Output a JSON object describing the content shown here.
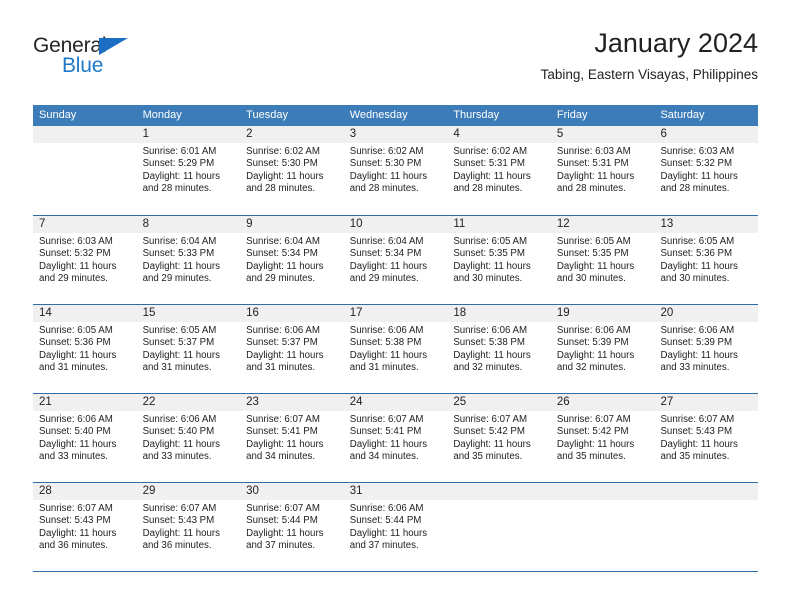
{
  "logo": {
    "text_primary": "General",
    "text_secondary": "Blue",
    "triangle_icon": "blue-triangle-icon",
    "colors": {
      "primary": "#262626",
      "secondary": "#2079c8",
      "triangle": "#1b6ec2"
    }
  },
  "header": {
    "title": "January 2024",
    "subtitle": "Tabing, Eastern Visayas, Philippines"
  },
  "theme": {
    "header_bg": "#3c7cb8",
    "header_text": "#ffffff",
    "row_divider": "#2e6da8",
    "daynum_band_bg": "#f0f0f0",
    "body_text": "#222222"
  },
  "weekdays": [
    "Sunday",
    "Monday",
    "Tuesday",
    "Wednesday",
    "Thursday",
    "Friday",
    "Saturday"
  ],
  "weeks": [
    [
      {
        "day": "",
        "sunrise": "",
        "sunset": "",
        "daylight_line1": "",
        "daylight_line2": "",
        "empty": true
      },
      {
        "day": "1",
        "sunrise": "Sunrise: 6:01 AM",
        "sunset": "Sunset: 5:29 PM",
        "daylight_line1": "Daylight: 11 hours",
        "daylight_line2": "and 28 minutes."
      },
      {
        "day": "2",
        "sunrise": "Sunrise: 6:02 AM",
        "sunset": "Sunset: 5:30 PM",
        "daylight_line1": "Daylight: 11 hours",
        "daylight_line2": "and 28 minutes."
      },
      {
        "day": "3",
        "sunrise": "Sunrise: 6:02 AM",
        "sunset": "Sunset: 5:30 PM",
        "daylight_line1": "Daylight: 11 hours",
        "daylight_line2": "and 28 minutes."
      },
      {
        "day": "4",
        "sunrise": "Sunrise: 6:02 AM",
        "sunset": "Sunset: 5:31 PM",
        "daylight_line1": "Daylight: 11 hours",
        "daylight_line2": "and 28 minutes."
      },
      {
        "day": "5",
        "sunrise": "Sunrise: 6:03 AM",
        "sunset": "Sunset: 5:31 PM",
        "daylight_line1": "Daylight: 11 hours",
        "daylight_line2": "and 28 minutes."
      },
      {
        "day": "6",
        "sunrise": "Sunrise: 6:03 AM",
        "sunset": "Sunset: 5:32 PM",
        "daylight_line1": "Daylight: 11 hours",
        "daylight_line2": "and 28 minutes."
      }
    ],
    [
      {
        "day": "7",
        "sunrise": "Sunrise: 6:03 AM",
        "sunset": "Sunset: 5:32 PM",
        "daylight_line1": "Daylight: 11 hours",
        "daylight_line2": "and 29 minutes."
      },
      {
        "day": "8",
        "sunrise": "Sunrise: 6:04 AM",
        "sunset": "Sunset: 5:33 PM",
        "daylight_line1": "Daylight: 11 hours",
        "daylight_line2": "and 29 minutes."
      },
      {
        "day": "9",
        "sunrise": "Sunrise: 6:04 AM",
        "sunset": "Sunset: 5:34 PM",
        "daylight_line1": "Daylight: 11 hours",
        "daylight_line2": "and 29 minutes."
      },
      {
        "day": "10",
        "sunrise": "Sunrise: 6:04 AM",
        "sunset": "Sunset: 5:34 PM",
        "daylight_line1": "Daylight: 11 hours",
        "daylight_line2": "and 29 minutes."
      },
      {
        "day": "11",
        "sunrise": "Sunrise: 6:05 AM",
        "sunset": "Sunset: 5:35 PM",
        "daylight_line1": "Daylight: 11 hours",
        "daylight_line2": "and 30 minutes."
      },
      {
        "day": "12",
        "sunrise": "Sunrise: 6:05 AM",
        "sunset": "Sunset: 5:35 PM",
        "daylight_line1": "Daylight: 11 hours",
        "daylight_line2": "and 30 minutes."
      },
      {
        "day": "13",
        "sunrise": "Sunrise: 6:05 AM",
        "sunset": "Sunset: 5:36 PM",
        "daylight_line1": "Daylight: 11 hours",
        "daylight_line2": "and 30 minutes."
      }
    ],
    [
      {
        "day": "14",
        "sunrise": "Sunrise: 6:05 AM",
        "sunset": "Sunset: 5:36 PM",
        "daylight_line1": "Daylight: 11 hours",
        "daylight_line2": "and 31 minutes."
      },
      {
        "day": "15",
        "sunrise": "Sunrise: 6:05 AM",
        "sunset": "Sunset: 5:37 PM",
        "daylight_line1": "Daylight: 11 hours",
        "daylight_line2": "and 31 minutes."
      },
      {
        "day": "16",
        "sunrise": "Sunrise: 6:06 AM",
        "sunset": "Sunset: 5:37 PM",
        "daylight_line1": "Daylight: 11 hours",
        "daylight_line2": "and 31 minutes."
      },
      {
        "day": "17",
        "sunrise": "Sunrise: 6:06 AM",
        "sunset": "Sunset: 5:38 PM",
        "daylight_line1": "Daylight: 11 hours",
        "daylight_line2": "and 31 minutes."
      },
      {
        "day": "18",
        "sunrise": "Sunrise: 6:06 AM",
        "sunset": "Sunset: 5:38 PM",
        "daylight_line1": "Daylight: 11 hours",
        "daylight_line2": "and 32 minutes."
      },
      {
        "day": "19",
        "sunrise": "Sunrise: 6:06 AM",
        "sunset": "Sunset: 5:39 PM",
        "daylight_line1": "Daylight: 11 hours",
        "daylight_line2": "and 32 minutes."
      },
      {
        "day": "20",
        "sunrise": "Sunrise: 6:06 AM",
        "sunset": "Sunset: 5:39 PM",
        "daylight_line1": "Daylight: 11 hours",
        "daylight_line2": "and 33 minutes."
      }
    ],
    [
      {
        "day": "21",
        "sunrise": "Sunrise: 6:06 AM",
        "sunset": "Sunset: 5:40 PM",
        "daylight_line1": "Daylight: 11 hours",
        "daylight_line2": "and 33 minutes."
      },
      {
        "day": "22",
        "sunrise": "Sunrise: 6:06 AM",
        "sunset": "Sunset: 5:40 PM",
        "daylight_line1": "Daylight: 11 hours",
        "daylight_line2": "and 33 minutes."
      },
      {
        "day": "23",
        "sunrise": "Sunrise: 6:07 AM",
        "sunset": "Sunset: 5:41 PM",
        "daylight_line1": "Daylight: 11 hours",
        "daylight_line2": "and 34 minutes."
      },
      {
        "day": "24",
        "sunrise": "Sunrise: 6:07 AM",
        "sunset": "Sunset: 5:41 PM",
        "daylight_line1": "Daylight: 11 hours",
        "daylight_line2": "and 34 minutes."
      },
      {
        "day": "25",
        "sunrise": "Sunrise: 6:07 AM",
        "sunset": "Sunset: 5:42 PM",
        "daylight_line1": "Daylight: 11 hours",
        "daylight_line2": "and 35 minutes."
      },
      {
        "day": "26",
        "sunrise": "Sunrise: 6:07 AM",
        "sunset": "Sunset: 5:42 PM",
        "daylight_line1": "Daylight: 11 hours",
        "daylight_line2": "and 35 minutes."
      },
      {
        "day": "27",
        "sunrise": "Sunrise: 6:07 AM",
        "sunset": "Sunset: 5:43 PM",
        "daylight_line1": "Daylight: 11 hours",
        "daylight_line2": "and 35 minutes."
      }
    ],
    [
      {
        "day": "28",
        "sunrise": "Sunrise: 6:07 AM",
        "sunset": "Sunset: 5:43 PM",
        "daylight_line1": "Daylight: 11 hours",
        "daylight_line2": "and 36 minutes."
      },
      {
        "day": "29",
        "sunrise": "Sunrise: 6:07 AM",
        "sunset": "Sunset: 5:43 PM",
        "daylight_line1": "Daylight: 11 hours",
        "daylight_line2": "and 36 minutes."
      },
      {
        "day": "30",
        "sunrise": "Sunrise: 6:07 AM",
        "sunset": "Sunset: 5:44 PM",
        "daylight_line1": "Daylight: 11 hours",
        "daylight_line2": "and 37 minutes."
      },
      {
        "day": "31",
        "sunrise": "Sunrise: 6:06 AM",
        "sunset": "Sunset: 5:44 PM",
        "daylight_line1": "Daylight: 11 hours",
        "daylight_line2": "and 37 minutes."
      },
      {
        "day": "",
        "sunrise": "",
        "sunset": "",
        "daylight_line1": "",
        "daylight_line2": "",
        "empty": true
      },
      {
        "day": "",
        "sunrise": "",
        "sunset": "",
        "daylight_line1": "",
        "daylight_line2": "",
        "empty": true
      },
      {
        "day": "",
        "sunrise": "",
        "sunset": "",
        "daylight_line1": "",
        "daylight_line2": "",
        "empty": true
      }
    ]
  ]
}
